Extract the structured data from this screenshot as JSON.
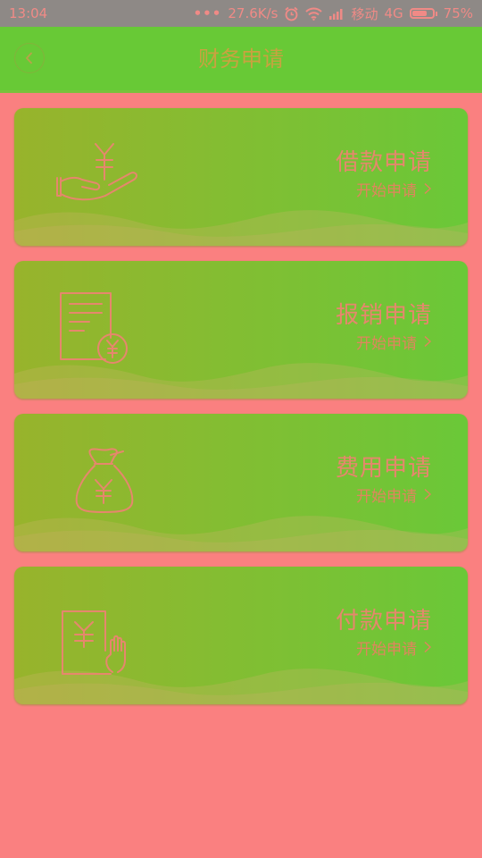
{
  "status_bar": {
    "time": "13:04",
    "dots": "•••",
    "speed": "27.6K/s",
    "carrier": "移动",
    "network": "4G",
    "battery_percent": "75%",
    "battery_level": 0.75,
    "icons": [
      "alarm-icon",
      "wifi-icon",
      "signal-icon",
      "battery-icon"
    ]
  },
  "header": {
    "title": "财务申请",
    "back_icon": "chevron-left-icon"
  },
  "cards": [
    {
      "title": "借款申请",
      "link": "开始申请",
      "icon": "hand-yuan-icon"
    },
    {
      "title": "报销申请",
      "link": "开始申请",
      "icon": "document-yuan-icon"
    },
    {
      "title": "费用申请",
      "link": "开始申请",
      "icon": "money-bag-icon"
    },
    {
      "title": "付款申请",
      "link": "开始申请",
      "icon": "bill-hand-icon"
    }
  ],
  "colors": {
    "page_background": "#fa8080",
    "header_background": "#68c936",
    "card_gradient_start": "#98b32c",
    "card_gradient_end": "#6ac838",
    "title_text": "#c9a240",
    "card_text": "#e6876d",
    "status_bar": "#8e8986"
  }
}
